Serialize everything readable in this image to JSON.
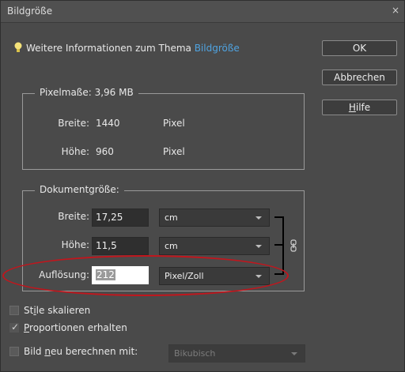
{
  "window": {
    "title": "Bildgröße",
    "close": "×"
  },
  "info": {
    "text": "Weitere Informationen zum Thema",
    "link": "Bildgröße"
  },
  "buttons": {
    "ok": "OK",
    "cancel": "Abbrechen",
    "help_mnemonic": "H",
    "help_rest": "ilfe"
  },
  "pixel": {
    "legend": "Pixelmaße: 3,96 MB",
    "width_label": "Breite:",
    "width_value": "1440",
    "width_unit": "Pixel",
    "height_label": "Höhe:",
    "height_value": "960",
    "height_unit": "Pixel"
  },
  "doc": {
    "legend": "Dokumentgröße:",
    "width_label": "Breite:",
    "width_value": "17,25",
    "width_unit": "cm",
    "height_label": "Höhe:",
    "height_value": "11,5",
    "height_unit": "cm",
    "res_label": "Auflösung:",
    "res_value": "212",
    "res_unit": "Pixel/Zoll"
  },
  "options": {
    "scale_styles_a": "St",
    "scale_styles_u": "i",
    "scale_styles_b": "le skalieren",
    "constrain_u": "P",
    "constrain_b": "roportionen erhalten",
    "resample_a": "Bild ",
    "resample_u": "n",
    "resample_b": "eu berechnen mit:",
    "resample_method": "Bikubisch",
    "scale_styles_checked": false,
    "constrain_checked": true,
    "resample_checked": false
  },
  "colors": {
    "background": "#4a4a4a",
    "link": "#4fa3e0",
    "highlight": "#c1161d"
  }
}
